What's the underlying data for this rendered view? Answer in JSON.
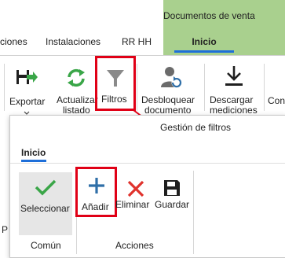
{
  "tabs": {
    "items": [
      "ciones",
      "Instalaciones",
      "RR HH"
    ],
    "context_title": "Documentos de venta",
    "context_active": "Inicio"
  },
  "ribbon": {
    "exportar": "Exportar",
    "actualizar_1": "Actualizar",
    "actualizar_2": "listado",
    "filtros": "Filtros",
    "desbloquear_1": "Desbloquear",
    "desbloquear_2": "documento",
    "descargar_1": "Descargar",
    "descargar_2": "mediciones",
    "cut_label": "Con",
    "left_cut": "P"
  },
  "popup": {
    "title": "Gestión de filtros",
    "tab": "Inicio",
    "buttons": {
      "seleccionar": "Seleccionar",
      "anadir": "Añadir",
      "eliminar": "Eliminar",
      "guardar": "Guardar"
    },
    "groups": {
      "comun": "Común",
      "acciones": "Acciones"
    }
  },
  "colors": {
    "context_green": "#a9d08e",
    "highlight_red": "#e00016",
    "accent_blue": "#1e6fd9",
    "check_green": "#3aa648",
    "plus_blue": "#2f6fa8",
    "x_red": "#e0322c"
  }
}
